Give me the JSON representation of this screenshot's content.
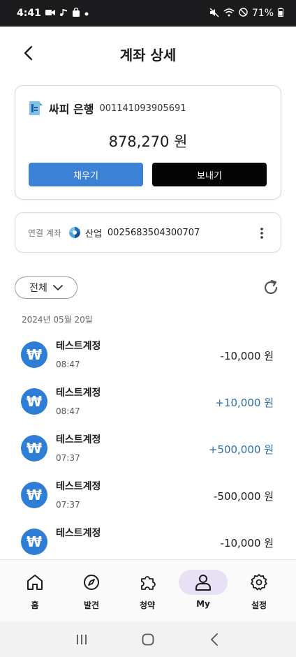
{
  "status_bar": {
    "time": "4:41",
    "battery": "71%",
    "left_icons": [
      "video-icon",
      "music-icon",
      "bag-icon",
      "dot-icon"
    ],
    "right_icons": [
      "mute-icon",
      "wifi-icon",
      "dnd-icon",
      "battery-icon"
    ]
  },
  "header": {
    "title": "계좌 상세"
  },
  "account": {
    "bank_name": "싸피 은행",
    "account_number": "001141093905691",
    "balance": "878,270 원",
    "charge_label": "채우기",
    "send_label": "보내기"
  },
  "linked_account": {
    "label": "연결 계좌",
    "bank": "산업",
    "number": "0025683504300707"
  },
  "filter": {
    "selected": "전체"
  },
  "transactions": {
    "date": "2024년 05월 20일",
    "items": [
      {
        "name": "테스트계정",
        "time": "08:47",
        "amount": "-10,000 원",
        "type": "minus",
        "avatar": "₩"
      },
      {
        "name": "테스트계정",
        "time": "08:47",
        "amount": "+10,000 원",
        "type": "plus",
        "avatar": "₩"
      },
      {
        "name": "테스트계정",
        "time": "07:37",
        "amount": "+500,000 원",
        "type": "plus",
        "avatar": "₩"
      },
      {
        "name": "테스트계정",
        "time": "07:37",
        "amount": "-500,000 원",
        "type": "minus",
        "avatar": "₩"
      },
      {
        "name": "테스트계정",
        "time": "",
        "amount": "-10,000 원",
        "type": "minus",
        "avatar": "₩"
      }
    ]
  },
  "bottom_nav": {
    "items": [
      {
        "label": "홈",
        "icon": "home-icon"
      },
      {
        "label": "발견",
        "icon": "compass-icon"
      },
      {
        "label": "청약",
        "icon": "puzzle-icon"
      },
      {
        "label": "My",
        "icon": "user-icon",
        "active": true
      },
      {
        "label": "설정",
        "icon": "gear-icon"
      }
    ]
  },
  "colors": {
    "accent": "#3b82d6",
    "positive": "#2d6ea6",
    "nav_active": "#e8e0f5"
  }
}
